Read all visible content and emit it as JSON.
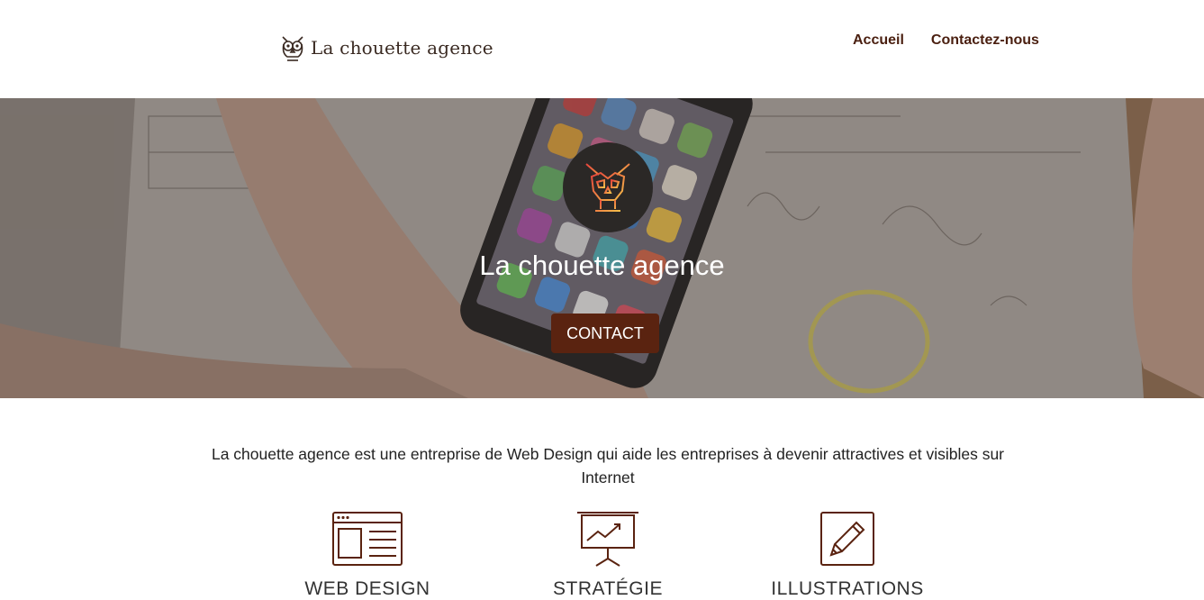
{
  "header": {
    "logo_text": "La chouette agence",
    "nav": [
      {
        "label": "Accueil"
      },
      {
        "label": "Contactez-nous"
      }
    ]
  },
  "hero": {
    "title": "La chouette agence",
    "cta_label": "CONTACT"
  },
  "intro": {
    "text": "La chouette agence est une entreprise de Web Design qui aide les entreprises à devenir attractives et visibles sur Internet"
  },
  "services": [
    {
      "title": "WEB DESIGN",
      "icon": "web-design-icon"
    },
    {
      "title": "STRATÉGIE",
      "icon": "strategy-chart-icon"
    },
    {
      "title": "ILLUSTRATIONS",
      "icon": "pencil-icon"
    }
  ],
  "colors": {
    "brand": "#5a2310",
    "nav_text": "#4a1f10",
    "badge_bg": "#2b2826"
  }
}
